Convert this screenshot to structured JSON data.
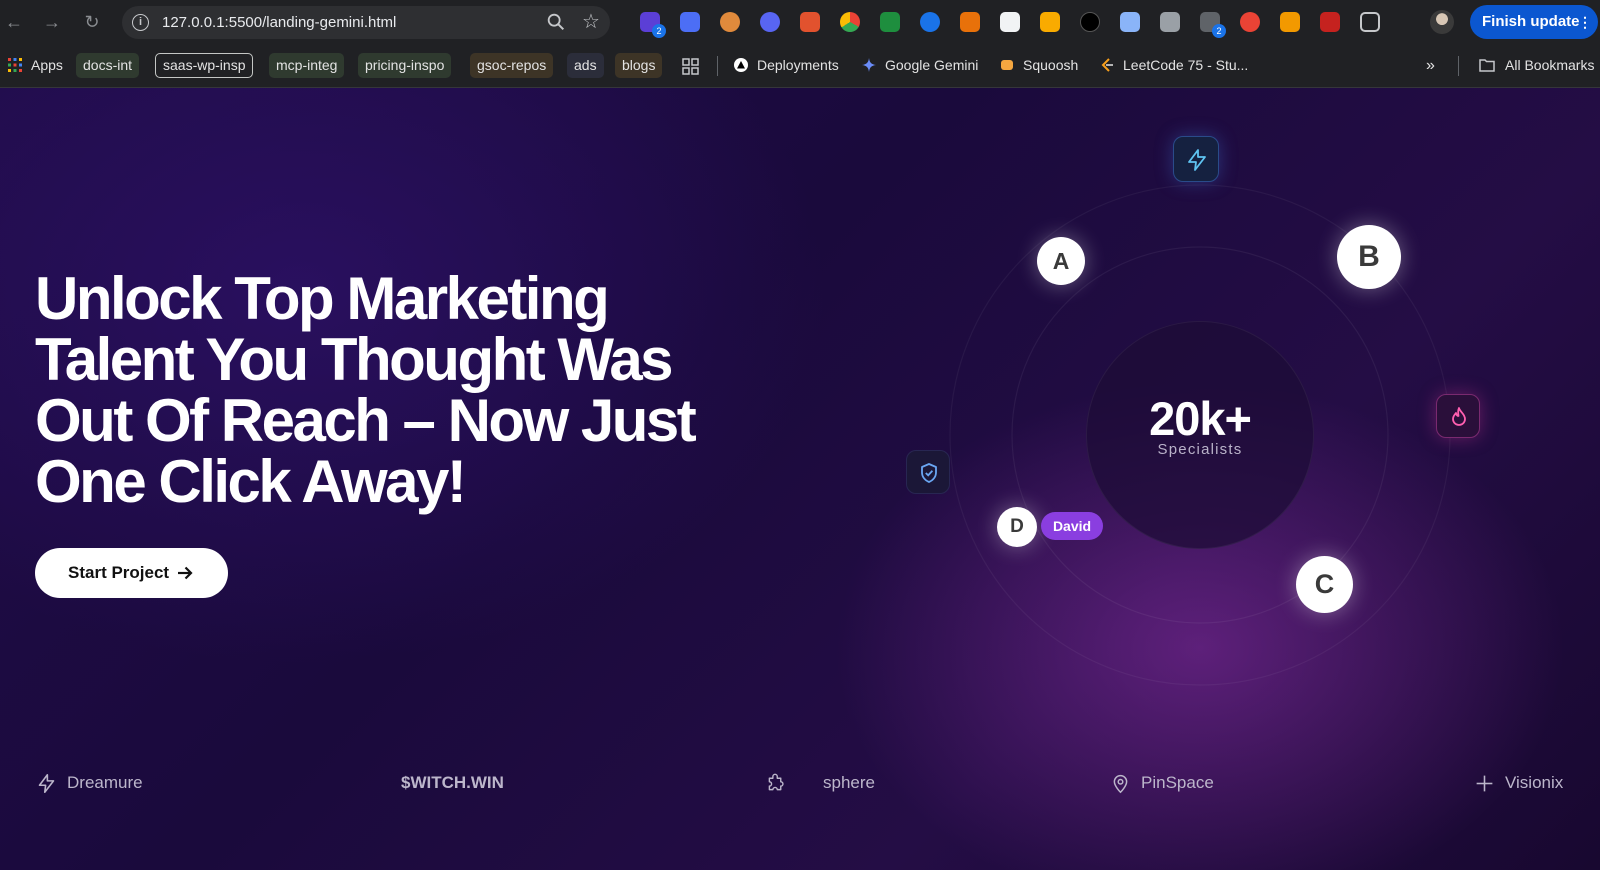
{
  "browser": {
    "url": "127.0.0.1:5500/landing-gemini.html",
    "update_button": "Finish update",
    "extension_badges": [
      "2",
      "2"
    ],
    "bookmarks": {
      "apps": "Apps",
      "items": [
        "docs-int",
        "saas-wp-insp",
        "mcp-integ",
        "pricing-inspo",
        "gsoc-repos",
        "ads",
        "blogs"
      ],
      "links": [
        "Deployments",
        "Google Gemini",
        "Squoosh",
        "LeetCode 75 - Stu..."
      ],
      "all_bookmarks": "All Bookmarks"
    }
  },
  "hero": {
    "title_lines": [
      "Unlock Top Marketing",
      "Talent You Thought Was",
      "Out Of Reach – Now Just",
      "One Click Away!"
    ],
    "cta_label": "Start Project"
  },
  "network": {
    "stat_value": "20k+",
    "stat_label": "Specialists",
    "nodes": [
      "A",
      "B",
      "C",
      "D"
    ],
    "tag": "David"
  },
  "logos": [
    "Dreamure",
    "$WITCH.WIN",
    "sphere",
    "PinSpace",
    "Visionix"
  ],
  "colors": {
    "accent": "#8a3ee0",
    "background": "#1a0a3c",
    "bookmark_pill": "#2f3a2f",
    "update_button": "#0b57d0"
  }
}
